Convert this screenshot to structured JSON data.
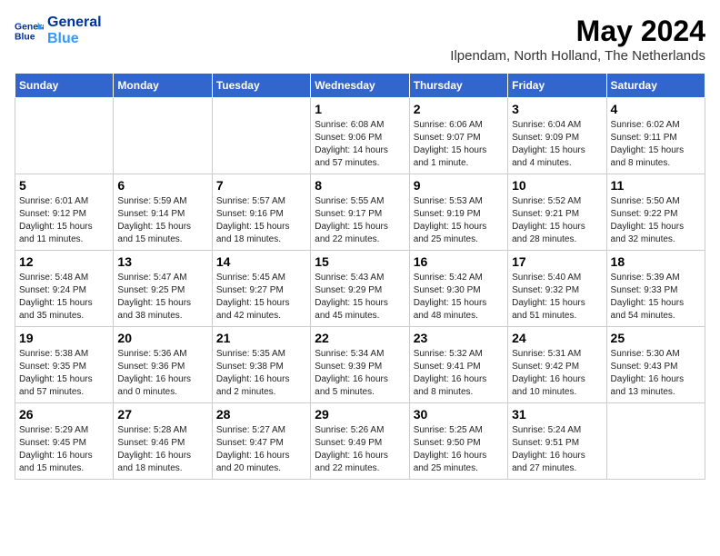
{
  "header": {
    "logo_line1": "General",
    "logo_line2": "Blue",
    "title": "May 2024",
    "subtitle": "Ilpendam, North Holland, The Netherlands"
  },
  "days_of_week": [
    "Sunday",
    "Monday",
    "Tuesday",
    "Wednesday",
    "Thursday",
    "Friday",
    "Saturday"
  ],
  "weeks": [
    [
      {
        "day": "",
        "info": ""
      },
      {
        "day": "",
        "info": ""
      },
      {
        "day": "",
        "info": ""
      },
      {
        "day": "1",
        "info": "Sunrise: 6:08 AM\nSunset: 9:06 PM\nDaylight: 14 hours\nand 57 minutes."
      },
      {
        "day": "2",
        "info": "Sunrise: 6:06 AM\nSunset: 9:07 PM\nDaylight: 15 hours\nand 1 minute."
      },
      {
        "day": "3",
        "info": "Sunrise: 6:04 AM\nSunset: 9:09 PM\nDaylight: 15 hours\nand 4 minutes."
      },
      {
        "day": "4",
        "info": "Sunrise: 6:02 AM\nSunset: 9:11 PM\nDaylight: 15 hours\nand 8 minutes."
      }
    ],
    [
      {
        "day": "5",
        "info": "Sunrise: 6:01 AM\nSunset: 9:12 PM\nDaylight: 15 hours\nand 11 minutes."
      },
      {
        "day": "6",
        "info": "Sunrise: 5:59 AM\nSunset: 9:14 PM\nDaylight: 15 hours\nand 15 minutes."
      },
      {
        "day": "7",
        "info": "Sunrise: 5:57 AM\nSunset: 9:16 PM\nDaylight: 15 hours\nand 18 minutes."
      },
      {
        "day": "8",
        "info": "Sunrise: 5:55 AM\nSunset: 9:17 PM\nDaylight: 15 hours\nand 22 minutes."
      },
      {
        "day": "9",
        "info": "Sunrise: 5:53 AM\nSunset: 9:19 PM\nDaylight: 15 hours\nand 25 minutes."
      },
      {
        "day": "10",
        "info": "Sunrise: 5:52 AM\nSunset: 9:21 PM\nDaylight: 15 hours\nand 28 minutes."
      },
      {
        "day": "11",
        "info": "Sunrise: 5:50 AM\nSunset: 9:22 PM\nDaylight: 15 hours\nand 32 minutes."
      }
    ],
    [
      {
        "day": "12",
        "info": "Sunrise: 5:48 AM\nSunset: 9:24 PM\nDaylight: 15 hours\nand 35 minutes."
      },
      {
        "day": "13",
        "info": "Sunrise: 5:47 AM\nSunset: 9:25 PM\nDaylight: 15 hours\nand 38 minutes."
      },
      {
        "day": "14",
        "info": "Sunrise: 5:45 AM\nSunset: 9:27 PM\nDaylight: 15 hours\nand 42 minutes."
      },
      {
        "day": "15",
        "info": "Sunrise: 5:43 AM\nSunset: 9:29 PM\nDaylight: 15 hours\nand 45 minutes."
      },
      {
        "day": "16",
        "info": "Sunrise: 5:42 AM\nSunset: 9:30 PM\nDaylight: 15 hours\nand 48 minutes."
      },
      {
        "day": "17",
        "info": "Sunrise: 5:40 AM\nSunset: 9:32 PM\nDaylight: 15 hours\nand 51 minutes."
      },
      {
        "day": "18",
        "info": "Sunrise: 5:39 AM\nSunset: 9:33 PM\nDaylight: 15 hours\nand 54 minutes."
      }
    ],
    [
      {
        "day": "19",
        "info": "Sunrise: 5:38 AM\nSunset: 9:35 PM\nDaylight: 15 hours\nand 57 minutes."
      },
      {
        "day": "20",
        "info": "Sunrise: 5:36 AM\nSunset: 9:36 PM\nDaylight: 16 hours\nand 0 minutes."
      },
      {
        "day": "21",
        "info": "Sunrise: 5:35 AM\nSunset: 9:38 PM\nDaylight: 16 hours\nand 2 minutes."
      },
      {
        "day": "22",
        "info": "Sunrise: 5:34 AM\nSunset: 9:39 PM\nDaylight: 16 hours\nand 5 minutes."
      },
      {
        "day": "23",
        "info": "Sunrise: 5:32 AM\nSunset: 9:41 PM\nDaylight: 16 hours\nand 8 minutes."
      },
      {
        "day": "24",
        "info": "Sunrise: 5:31 AM\nSunset: 9:42 PM\nDaylight: 16 hours\nand 10 minutes."
      },
      {
        "day": "25",
        "info": "Sunrise: 5:30 AM\nSunset: 9:43 PM\nDaylight: 16 hours\nand 13 minutes."
      }
    ],
    [
      {
        "day": "26",
        "info": "Sunrise: 5:29 AM\nSunset: 9:45 PM\nDaylight: 16 hours\nand 15 minutes."
      },
      {
        "day": "27",
        "info": "Sunrise: 5:28 AM\nSunset: 9:46 PM\nDaylight: 16 hours\nand 18 minutes."
      },
      {
        "day": "28",
        "info": "Sunrise: 5:27 AM\nSunset: 9:47 PM\nDaylight: 16 hours\nand 20 minutes."
      },
      {
        "day": "29",
        "info": "Sunrise: 5:26 AM\nSunset: 9:49 PM\nDaylight: 16 hours\nand 22 minutes."
      },
      {
        "day": "30",
        "info": "Sunrise: 5:25 AM\nSunset: 9:50 PM\nDaylight: 16 hours\nand 25 minutes."
      },
      {
        "day": "31",
        "info": "Sunrise: 5:24 AM\nSunset: 9:51 PM\nDaylight: 16 hours\nand 27 minutes."
      },
      {
        "day": "",
        "info": ""
      }
    ]
  ]
}
